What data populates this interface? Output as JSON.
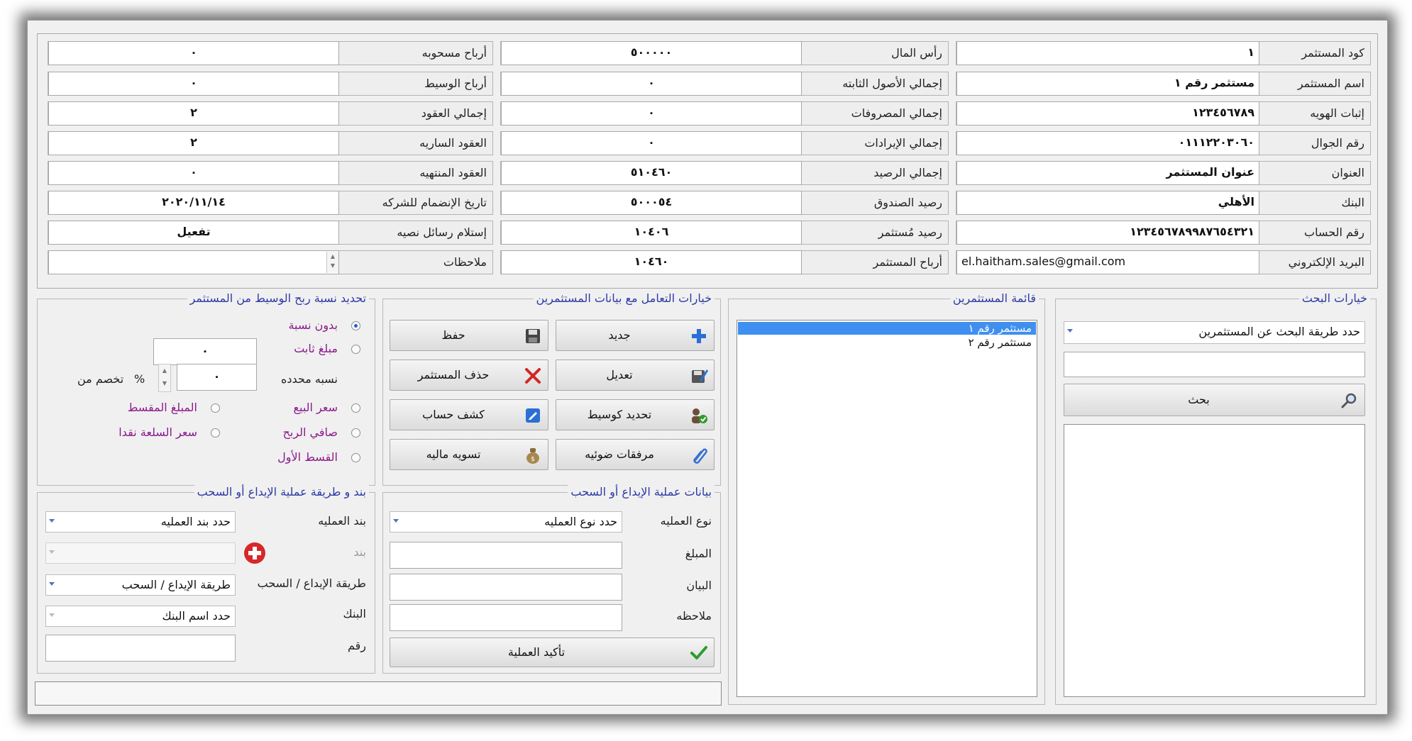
{
  "investor_info": {
    "col_right": [
      {
        "label": "كود المستثمر",
        "value": "١"
      },
      {
        "label": "اسم المستثمر",
        "value": "مستثمر رقم ١"
      },
      {
        "label": "إثبات الهويه",
        "value": "١٢٣٤٥٦٧٨٩"
      },
      {
        "label": "رقم الجوال",
        "value": "٠١١١٢٢٠٣٠٦٠"
      },
      {
        "label": "العنوان",
        "value": "عنوان المستثمر"
      },
      {
        "label": "البنك",
        "value": "الأهلي"
      },
      {
        "label": "رقم الحساب",
        "value": "١٢٣٤٥٦٧٨٩٩٨٧٦٥٤٣٢١"
      },
      {
        "label": "البريد الإلكتروني",
        "value": "el.haitham.sales@gmail.com"
      }
    ],
    "col_middle": [
      {
        "label": "رأس المال",
        "value": "٥٠٠٠٠٠"
      },
      {
        "label": "إجمالي الأصول الثابته",
        "value": "٠"
      },
      {
        "label": "إجمالي المصروفات",
        "value": "٠"
      },
      {
        "label": "إجمالي الإيرادات",
        "value": "٠"
      },
      {
        "label": "إجمالي الرصيد",
        "value": "٥١٠٤٦٠"
      },
      {
        "label": "رصيد الصندوق",
        "value": "٥٠٠٠٥٤"
      },
      {
        "label": "رصيد مُستثمر",
        "value": "١٠٤٠٦"
      },
      {
        "label": "أرباح المستثمر",
        "value": "١٠٤٦٠"
      }
    ],
    "col_left": [
      {
        "label": "أرباح مسحوبه",
        "value": "٠"
      },
      {
        "label": "أرباح الوسيط",
        "value": "٠"
      },
      {
        "label": "إجمالي العقود",
        "value": "٢"
      },
      {
        "label": "العقود الساريه",
        "value": "٢"
      },
      {
        "label": "العقود المنتهيه",
        "value": "٠"
      },
      {
        "label": "تاريخ الإنضمام للشركه",
        "value": "٢٠٢٠/١١/١٤"
      },
      {
        "label": "إستلام رسائل نصيه",
        "value": "تفعيل"
      },
      {
        "label": "ملاحظات",
        "value": ""
      }
    ]
  },
  "broker_profit": {
    "title": "تحديد نسبة ربح الوسيط من المستثمر",
    "no_ratio": "بدون نسبة",
    "fixed_amount": "مبلغ ثابت",
    "fixed_value": "٠",
    "specific_ratio": "نسبه محدده",
    "ratio_value": "٠",
    "percent_sign": "%",
    "deduct_from": "تخصم من",
    "sale_price": "سعر البيع",
    "installment_amount": "المبلغ المقسط",
    "net_profit": "صافي الربح",
    "cash_price": "سعر السلعة نقدا",
    "first_installment": "القسط الأول"
  },
  "actions": {
    "title": "خيارات التعامل مع بيانات المستثمرين",
    "new": "جديد",
    "save": "حفظ",
    "edit": "تعديل",
    "delete": "حذف المستثمر",
    "set_broker": "تحديد كوسيط",
    "statement": "كشف حساب",
    "attachments": "مرفقات ضوئيه",
    "settlement": "تسويه ماليه"
  },
  "investors_list": {
    "title": "قائمة المستثمرين",
    "items": [
      "مستثمر رقم ١",
      "مستثمر رقم ٢"
    ]
  },
  "search": {
    "title": "خيارات البحث",
    "method": "حدد طريقة البحث عن المستثمرين",
    "button": "بحث"
  },
  "item_method": {
    "title": "بند و طريقة عملية الإيداع أو السحب",
    "op_item_label": "بند العمليه",
    "op_item_value": "حدد بند العمليه",
    "item_label": "بند",
    "method_label": "طريقة الإيداع / السحب",
    "method_value": "طريقة الإيداع / السحب",
    "bank_label": "البنك",
    "bank_value": "حدد اسم البنك",
    "number_label": "رقم"
  },
  "operation": {
    "title": "بيانات عملية الإيداع أو السحب",
    "type_label": "نوع العمليه",
    "type_value": "حدد نوع العمليه",
    "amount_label": "المبلغ",
    "statement_label": "البيان",
    "note_label": "ملاحظه",
    "confirm": "تأكيد العملية"
  },
  "colors": {
    "group_title": "#2d3aa6",
    "radio_text": "#8b1a8b",
    "selection": "#3f8ff0"
  }
}
